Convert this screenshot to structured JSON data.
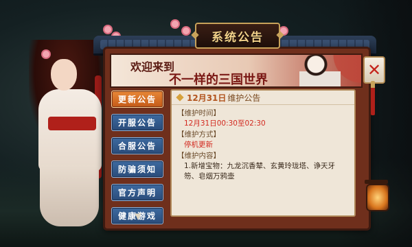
{
  "window": {
    "title": "系统公告"
  },
  "banner": {
    "line1": "欢迎来到",
    "line2": "不一样的三国世界"
  },
  "tabs": [
    {
      "label": "更新公告",
      "active": true
    },
    {
      "label": "开服公告",
      "active": false
    },
    {
      "label": "合服公告",
      "active": false
    },
    {
      "label": "防骗须知",
      "active": false
    },
    {
      "label": "官方声明",
      "active": false
    },
    {
      "label": "健康游戏",
      "active": false
    }
  ],
  "notice": {
    "title_date": "12月31日",
    "title_suffix": "维护公告",
    "sections": [
      {
        "header": "维护时间",
        "text": "12月31日00:30至02:30",
        "style": "red"
      },
      {
        "header": "维护方式",
        "text": "停机更新",
        "style": "red"
      },
      {
        "header": "维护内容",
        "text": "1.新增宝物：九龙沉香辇、玄黄玲珑塔、诤天牙笏、皂烟万鸦壶",
        "style": "normal"
      }
    ]
  },
  "icons": {
    "close": "close-icon",
    "scroll_down": "chevron-down-icon",
    "lantern": "lantern-icon"
  },
  "colors": {
    "accent": "#e88838",
    "tab": "#3d6aa0",
    "close": "#c4231a",
    "board": "#6f2f1c"
  }
}
